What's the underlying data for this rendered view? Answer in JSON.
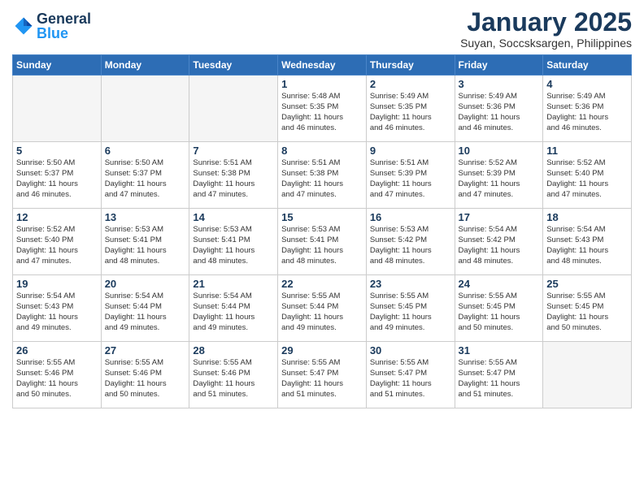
{
  "header": {
    "logo_text_general": "General",
    "logo_text_blue": "Blue",
    "month": "January 2025",
    "location": "Suyan, Soccsksargen, Philippines"
  },
  "days_of_week": [
    "Sunday",
    "Monday",
    "Tuesday",
    "Wednesday",
    "Thursday",
    "Friday",
    "Saturday"
  ],
  "weeks": [
    [
      {
        "day": "",
        "info": ""
      },
      {
        "day": "",
        "info": ""
      },
      {
        "day": "",
        "info": ""
      },
      {
        "day": "1",
        "info": "Sunrise: 5:48 AM\nSunset: 5:35 PM\nDaylight: 11 hours\nand 46 minutes."
      },
      {
        "day": "2",
        "info": "Sunrise: 5:49 AM\nSunset: 5:35 PM\nDaylight: 11 hours\nand 46 minutes."
      },
      {
        "day": "3",
        "info": "Sunrise: 5:49 AM\nSunset: 5:36 PM\nDaylight: 11 hours\nand 46 minutes."
      },
      {
        "day": "4",
        "info": "Sunrise: 5:49 AM\nSunset: 5:36 PM\nDaylight: 11 hours\nand 46 minutes."
      }
    ],
    [
      {
        "day": "5",
        "info": "Sunrise: 5:50 AM\nSunset: 5:37 PM\nDaylight: 11 hours\nand 46 minutes."
      },
      {
        "day": "6",
        "info": "Sunrise: 5:50 AM\nSunset: 5:37 PM\nDaylight: 11 hours\nand 47 minutes."
      },
      {
        "day": "7",
        "info": "Sunrise: 5:51 AM\nSunset: 5:38 PM\nDaylight: 11 hours\nand 47 minutes."
      },
      {
        "day": "8",
        "info": "Sunrise: 5:51 AM\nSunset: 5:38 PM\nDaylight: 11 hours\nand 47 minutes."
      },
      {
        "day": "9",
        "info": "Sunrise: 5:51 AM\nSunset: 5:39 PM\nDaylight: 11 hours\nand 47 minutes."
      },
      {
        "day": "10",
        "info": "Sunrise: 5:52 AM\nSunset: 5:39 PM\nDaylight: 11 hours\nand 47 minutes."
      },
      {
        "day": "11",
        "info": "Sunrise: 5:52 AM\nSunset: 5:40 PM\nDaylight: 11 hours\nand 47 minutes."
      }
    ],
    [
      {
        "day": "12",
        "info": "Sunrise: 5:52 AM\nSunset: 5:40 PM\nDaylight: 11 hours\nand 47 minutes."
      },
      {
        "day": "13",
        "info": "Sunrise: 5:53 AM\nSunset: 5:41 PM\nDaylight: 11 hours\nand 48 minutes."
      },
      {
        "day": "14",
        "info": "Sunrise: 5:53 AM\nSunset: 5:41 PM\nDaylight: 11 hours\nand 48 minutes."
      },
      {
        "day": "15",
        "info": "Sunrise: 5:53 AM\nSunset: 5:41 PM\nDaylight: 11 hours\nand 48 minutes."
      },
      {
        "day": "16",
        "info": "Sunrise: 5:53 AM\nSunset: 5:42 PM\nDaylight: 11 hours\nand 48 minutes."
      },
      {
        "day": "17",
        "info": "Sunrise: 5:54 AM\nSunset: 5:42 PM\nDaylight: 11 hours\nand 48 minutes."
      },
      {
        "day": "18",
        "info": "Sunrise: 5:54 AM\nSunset: 5:43 PM\nDaylight: 11 hours\nand 48 minutes."
      }
    ],
    [
      {
        "day": "19",
        "info": "Sunrise: 5:54 AM\nSunset: 5:43 PM\nDaylight: 11 hours\nand 49 minutes."
      },
      {
        "day": "20",
        "info": "Sunrise: 5:54 AM\nSunset: 5:44 PM\nDaylight: 11 hours\nand 49 minutes."
      },
      {
        "day": "21",
        "info": "Sunrise: 5:54 AM\nSunset: 5:44 PM\nDaylight: 11 hours\nand 49 minutes."
      },
      {
        "day": "22",
        "info": "Sunrise: 5:55 AM\nSunset: 5:44 PM\nDaylight: 11 hours\nand 49 minutes."
      },
      {
        "day": "23",
        "info": "Sunrise: 5:55 AM\nSunset: 5:45 PM\nDaylight: 11 hours\nand 49 minutes."
      },
      {
        "day": "24",
        "info": "Sunrise: 5:55 AM\nSunset: 5:45 PM\nDaylight: 11 hours\nand 50 minutes."
      },
      {
        "day": "25",
        "info": "Sunrise: 5:55 AM\nSunset: 5:45 PM\nDaylight: 11 hours\nand 50 minutes."
      }
    ],
    [
      {
        "day": "26",
        "info": "Sunrise: 5:55 AM\nSunset: 5:46 PM\nDaylight: 11 hours\nand 50 minutes."
      },
      {
        "day": "27",
        "info": "Sunrise: 5:55 AM\nSunset: 5:46 PM\nDaylight: 11 hours\nand 50 minutes."
      },
      {
        "day": "28",
        "info": "Sunrise: 5:55 AM\nSunset: 5:46 PM\nDaylight: 11 hours\nand 51 minutes."
      },
      {
        "day": "29",
        "info": "Sunrise: 5:55 AM\nSunset: 5:47 PM\nDaylight: 11 hours\nand 51 minutes."
      },
      {
        "day": "30",
        "info": "Sunrise: 5:55 AM\nSunset: 5:47 PM\nDaylight: 11 hours\nand 51 minutes."
      },
      {
        "day": "31",
        "info": "Sunrise: 5:55 AM\nSunset: 5:47 PM\nDaylight: 11 hours\nand 51 minutes."
      },
      {
        "day": "",
        "info": ""
      }
    ]
  ]
}
